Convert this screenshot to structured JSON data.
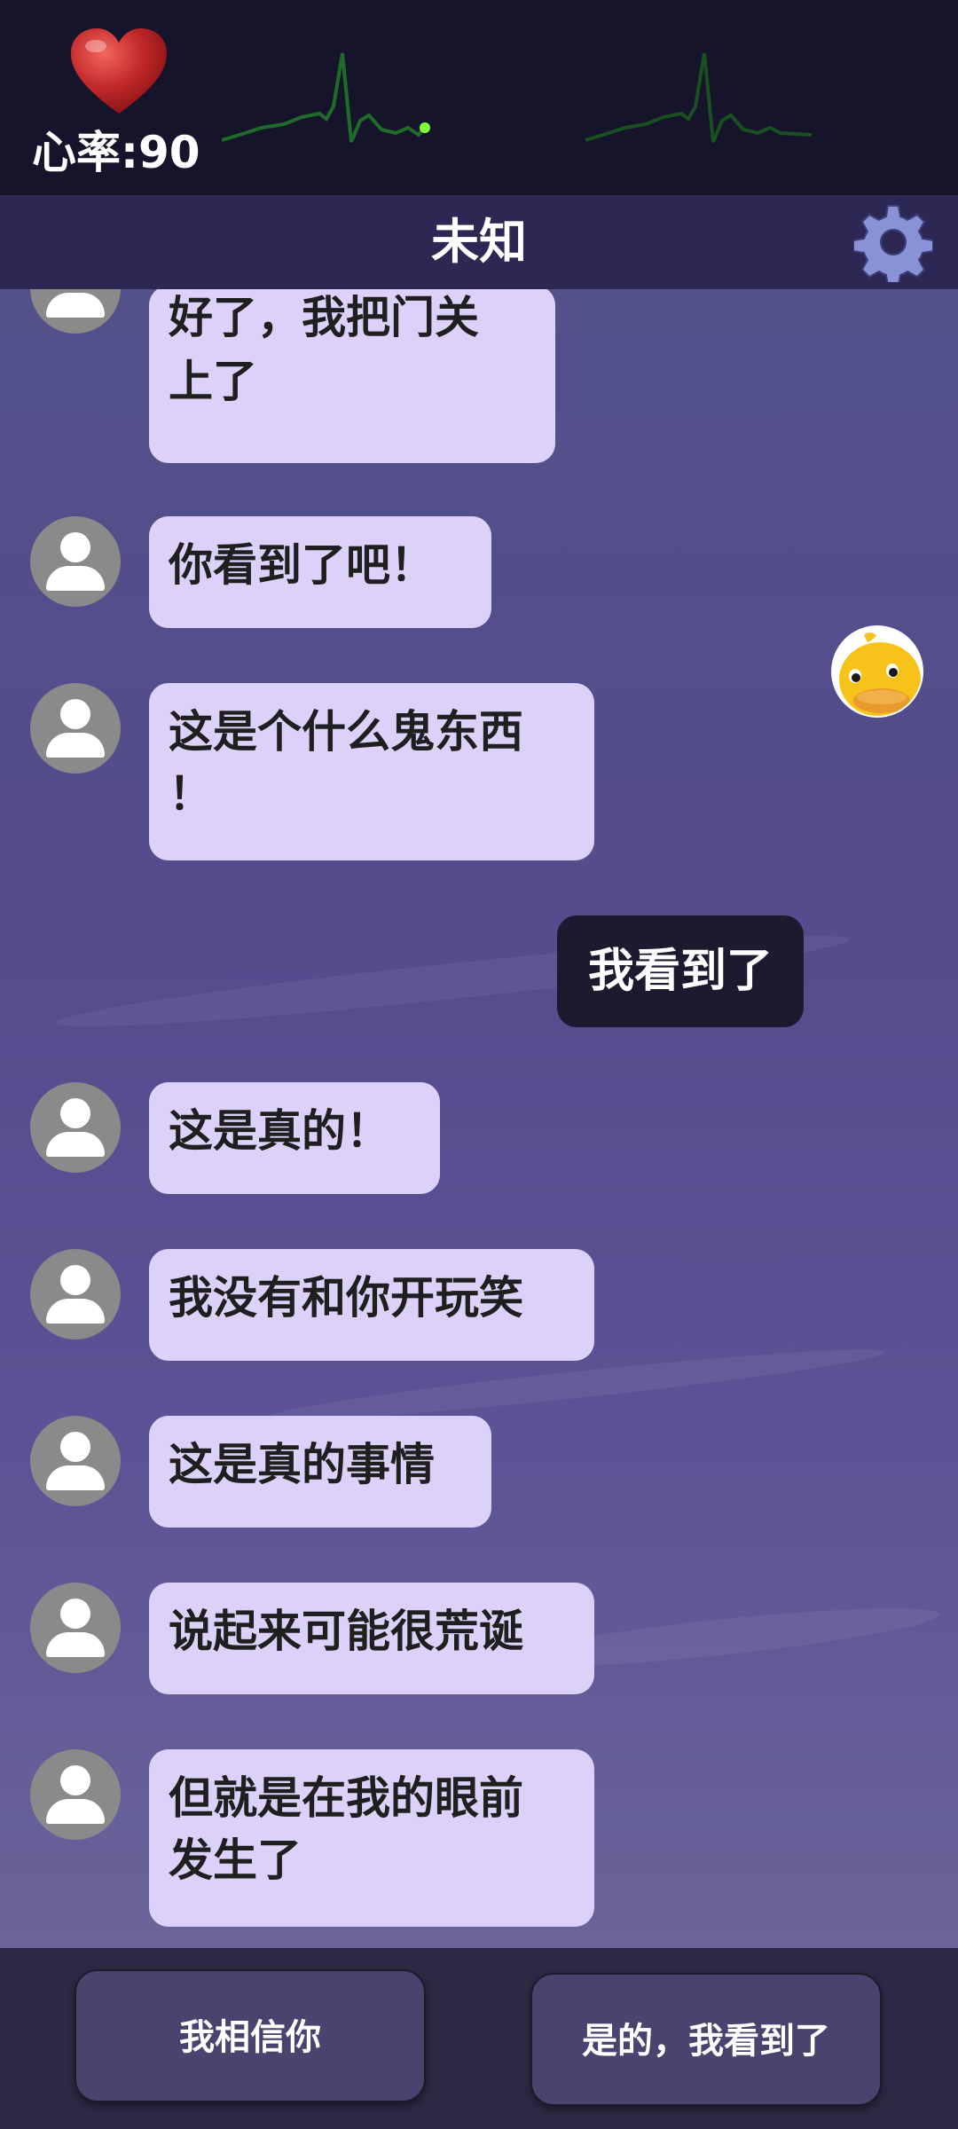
{
  "hud": {
    "heart_rate_label": "心率:90",
    "colors": {
      "background": "#16142a",
      "ecg": "#1f6b2a",
      "ecg_dot": "#7dff3a",
      "heart": "#c0282b"
    }
  },
  "header": {
    "title": "未知",
    "settings_icon": "gear-icon",
    "colors": {
      "background": "#2d2753",
      "gear": "#8a92d6"
    }
  },
  "messages": [
    {
      "sender": "other",
      "text": "好了，我把门关\n上了"
    },
    {
      "sender": "other",
      "text": "你看到了吧！"
    },
    {
      "sender": "other",
      "text": "这是个什么鬼东西\n！"
    },
    {
      "sender": "me",
      "text": "我看到了"
    },
    {
      "sender": "other",
      "text": "这是真的！"
    },
    {
      "sender": "other",
      "text": "我没有和你开玩笑"
    },
    {
      "sender": "other",
      "text": "这是真的事情"
    },
    {
      "sender": "other",
      "text": "说起来可能很荒诞"
    },
    {
      "sender": "other",
      "text": "但就是在我的眼前\n发生了"
    }
  ],
  "choices": [
    {
      "label": "我相信你"
    },
    {
      "label": "是的，我看到了"
    }
  ],
  "colors": {
    "other_bubble": "#dcd2f9",
    "my_bubble": "#1f1930",
    "choice_button": "#4b426e",
    "bottom_bar": "#2e2a45"
  }
}
